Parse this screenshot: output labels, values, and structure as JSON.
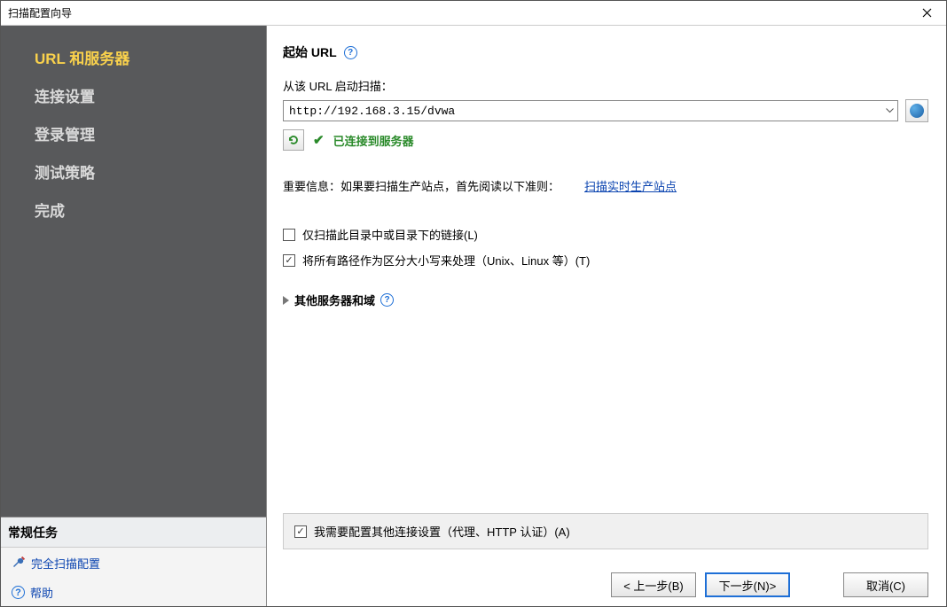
{
  "window": {
    "title": "扫描配置向导"
  },
  "sidebar": {
    "nav": [
      {
        "label": "URL 和服务器",
        "active": true
      },
      {
        "label": "连接设置",
        "active": false
      },
      {
        "label": "登录管理",
        "active": false
      },
      {
        "label": "测试策略",
        "active": false
      },
      {
        "label": "完成",
        "active": false
      }
    ],
    "tasks_header": "常规任务",
    "task_full_scan": "完全扫描配置",
    "task_help": "帮助"
  },
  "main": {
    "section_title": "起始 URL",
    "url_label": "从该 URL 启动扫描：",
    "url_value": "http://192.168.3.15/dvwa",
    "status_connected": "已连接到服务器",
    "info_prefix": "重要信息：如果要扫描生产站点，首先阅读以下准则：",
    "info_link": "扫描实时生产站点",
    "cb_only_dir": "仅扫描此目录中或目录下的链接(L)",
    "cb_case_sensitive": "将所有路径作为区分大小写来处理（Unix、Linux 等）(T)",
    "collapse_other": "其他服务器和域",
    "cb_need_config": "我需要配置其他连接设置（代理、HTTP 认证）(A)"
  },
  "footer": {
    "back": "< 上一步(B)",
    "next": "下一步(N)>",
    "cancel": "取消(C)"
  }
}
